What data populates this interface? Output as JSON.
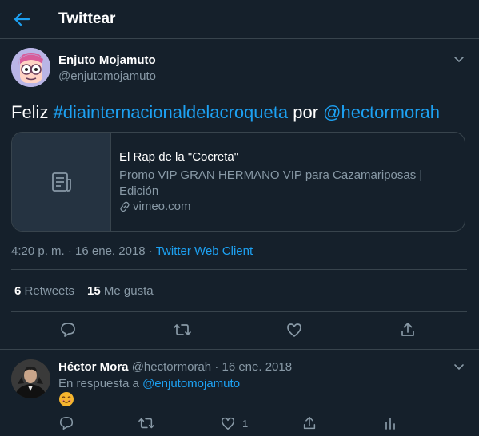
{
  "header": {
    "title": "Twittear",
    "back_icon": "arrow-left-icon"
  },
  "tweet": {
    "author_name": "Enjuto Mojamuto",
    "author_handle": "@enjutomojamuto",
    "text_prefix": "Feliz ",
    "hashtag": "#diainternacionaldelacroqueta",
    "text_middle": " por ",
    "mention": "@hectormorah",
    "card": {
      "title": "El Rap de la \"Cocreta\"",
      "description": "Promo VIP GRAN HERMANO VIP para Cazamariposas | Edición",
      "domain": "vimeo.com"
    },
    "time": "4:20 p. m.",
    "date": "16 ene. 2018",
    "separator": "·",
    "source": "Twitter Web Client",
    "retweets_count": "6",
    "retweets_label": "Retweets",
    "likes_count": "15",
    "likes_label": "Me gusta"
  },
  "reply": {
    "author_name": "Héctor Mora",
    "author_handle": "@hectormorah",
    "separator": "·",
    "date": "16 ene. 2018",
    "replying_prefix": "En respuesta a ",
    "replying_to": "@enjutomojamuto",
    "emoji": "smiling-face-icon",
    "like_count": "1"
  },
  "colors": {
    "background": "#15202b",
    "accent": "#1da1f2",
    "secondary_text": "#8899a6",
    "border": "#38444d"
  }
}
